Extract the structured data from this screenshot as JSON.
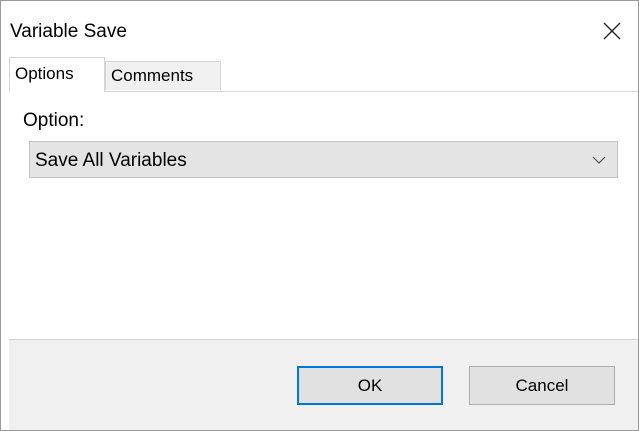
{
  "window": {
    "title": "Variable Save"
  },
  "tabs": [
    {
      "label": "Options",
      "active": true
    },
    {
      "label": "Comments",
      "active": false
    }
  ],
  "options_tab": {
    "option_label": "Option:",
    "option_select": {
      "selected": "Save All Variables"
    }
  },
  "buttons": {
    "ok_label": "OK",
    "cancel_label": "Cancel"
  },
  "icons": {
    "close": "close-icon",
    "dropdown": "chevron-down-icon"
  },
  "colors": {
    "default_button_border": "#0078d7",
    "footer_background": "#f0f0f0",
    "select_background": "#e4e4e4"
  }
}
